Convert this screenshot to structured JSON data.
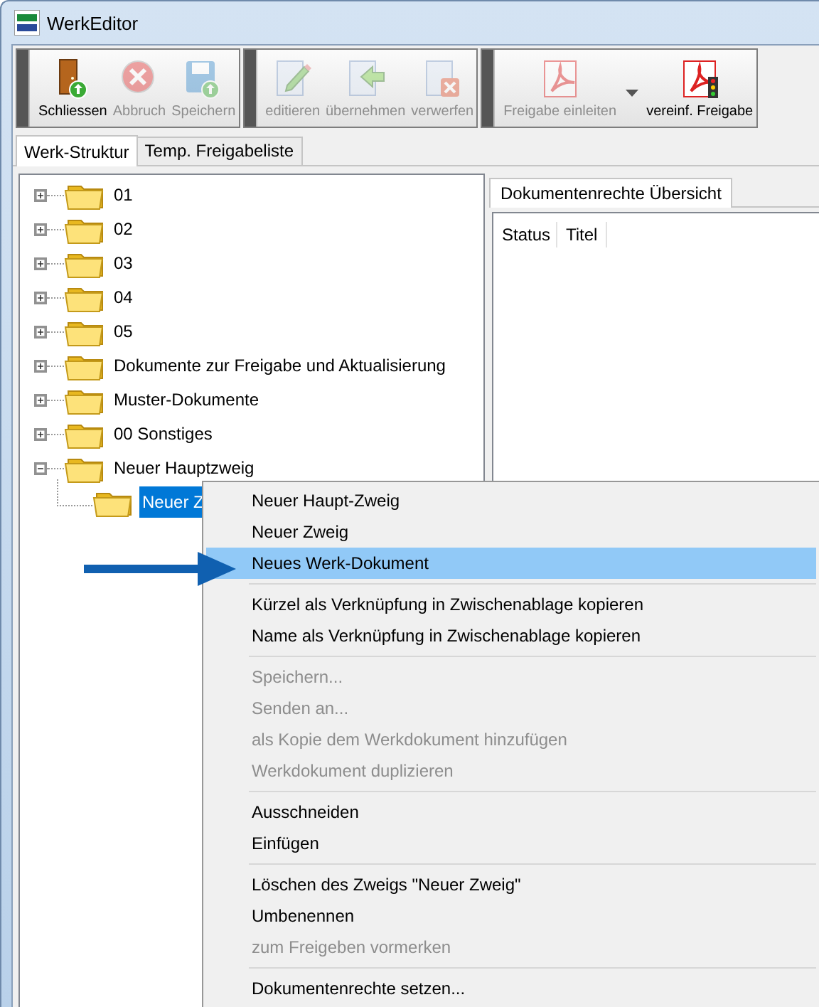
{
  "window": {
    "title": "WerkEditor"
  },
  "toolbar": {
    "groups": [
      {
        "buttons": [
          {
            "label": "Schliessen",
            "disabled": false
          },
          {
            "label": "Abbruch",
            "disabled": true
          },
          {
            "label": "Speichern",
            "disabled": true
          }
        ]
      },
      {
        "buttons": [
          {
            "label": "editieren",
            "disabled": true
          },
          {
            "label": "übernehmen",
            "disabled": true
          },
          {
            "label": "verwerfen",
            "disabled": true
          }
        ]
      },
      {
        "buttons": [
          {
            "label": "Freigabe einleiten",
            "disabled": true,
            "dropdown": true
          },
          {
            "label": "vereinf. Freigabe",
            "disabled": false
          }
        ]
      }
    ]
  },
  "tabs": [
    {
      "label": "Werk-Struktur",
      "selected": true
    },
    {
      "label": "Temp. Freigabeliste",
      "selected": false
    }
  ],
  "tree": [
    {
      "label": "01",
      "expanded": false,
      "selected": false
    },
    {
      "label": "02",
      "expanded": false,
      "selected": false
    },
    {
      "label": "03",
      "expanded": false,
      "selected": false
    },
    {
      "label": "04",
      "expanded": false,
      "selected": false
    },
    {
      "label": "05",
      "expanded": false,
      "selected": false
    },
    {
      "label": "Dokumente zur Freigabe und Aktualisierung",
      "expanded": false,
      "selected": false
    },
    {
      "label": "Muster-Dokumente",
      "expanded": false,
      "selected": false
    },
    {
      "label": "00 Sonstiges",
      "expanded": false,
      "selected": false
    },
    {
      "label": "Neuer Hauptzweig",
      "expanded": true,
      "selected": false,
      "children": [
        {
          "label": "Neuer Z",
          "selected": true
        }
      ]
    }
  ],
  "right_panel": {
    "tabs": [
      {
        "label": "Dokumentenrechte Übersicht",
        "selected": true
      }
    ],
    "columns": [
      "Status",
      "Titel"
    ]
  },
  "context_menu": [
    {
      "kind": "item",
      "label": "Neuer Haupt-Zweig",
      "disabled": false,
      "selected": false
    },
    {
      "kind": "item",
      "label": "Neuer Zweig",
      "disabled": false,
      "selected": false
    },
    {
      "kind": "item",
      "label": "Neues Werk-Dokument",
      "disabled": false,
      "selected": true
    },
    {
      "kind": "separator"
    },
    {
      "kind": "item",
      "label": "Kürzel als Verknüpfung in Zwischenablage kopieren",
      "disabled": false,
      "selected": false
    },
    {
      "kind": "item",
      "label": "Name als Verknüpfung in Zwischenablage kopieren",
      "disabled": false,
      "selected": false
    },
    {
      "kind": "separator"
    },
    {
      "kind": "item",
      "label": "Speichern...",
      "disabled": true,
      "selected": false
    },
    {
      "kind": "item",
      "label": "Senden an...",
      "disabled": true,
      "selected": false
    },
    {
      "kind": "item",
      "label": "als Kopie dem Werkdokument hinzufügen",
      "disabled": true,
      "selected": false
    },
    {
      "kind": "item",
      "label": "Werkdokument duplizieren",
      "disabled": true,
      "selected": false
    },
    {
      "kind": "separator"
    },
    {
      "kind": "item",
      "label": "Ausschneiden",
      "disabled": false,
      "selected": false
    },
    {
      "kind": "item",
      "label": "Einfügen",
      "disabled": false,
      "selected": false
    },
    {
      "kind": "separator"
    },
    {
      "kind": "item",
      "label": "Löschen des Zweigs \"Neuer Zweig\"",
      "disabled": false,
      "selected": false
    },
    {
      "kind": "item",
      "label": "Umbenennen",
      "disabled": false,
      "selected": false
    },
    {
      "kind": "item",
      "label": "zum Freigeben vormerken",
      "disabled": true,
      "selected": false
    },
    {
      "kind": "separator"
    },
    {
      "kind": "item",
      "label": "Dokumentenrechte setzen...",
      "disabled": false,
      "selected": false
    }
  ]
}
